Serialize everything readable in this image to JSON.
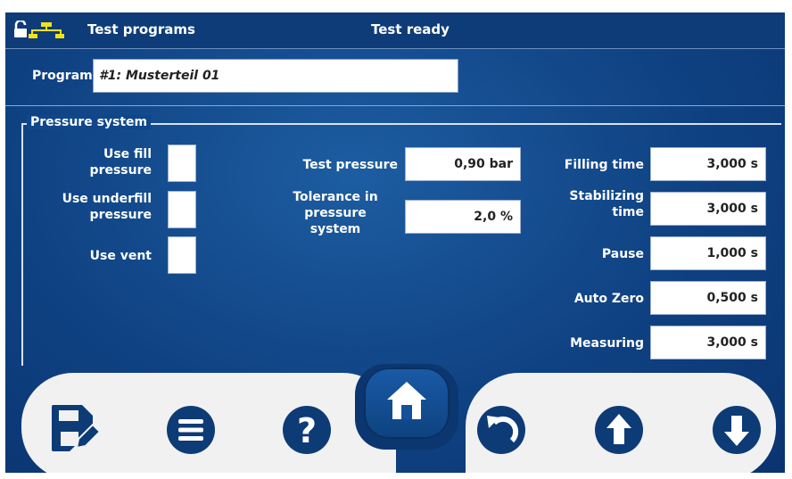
{
  "titlebar": {
    "lock_icon": "lock-open-icon",
    "network_icon": "network-icon",
    "title": "Test programs",
    "status": "Test ready"
  },
  "program": {
    "label": "Program",
    "value": "#1: Musterteil 01"
  },
  "pressure_system": {
    "legend": "Pressure system",
    "checkboxes": [
      {
        "label_line1": "Use fill",
        "label_line2": "pressure",
        "checked": false
      },
      {
        "label_line1": "Use underfill",
        "label_line2": "pressure",
        "checked": false
      },
      {
        "label_line1": "Use vent",
        "label_line2": "",
        "checked": false
      }
    ],
    "middle": [
      {
        "label": "Test pressure",
        "value": "0,90 bar"
      },
      {
        "label_lines": [
          "Tolerance in",
          "pressure",
          "system"
        ],
        "value": "2,0 %"
      }
    ],
    "times": [
      {
        "label_lines": [
          "Filling time"
        ],
        "value": "3,000 s"
      },
      {
        "label_lines": [
          "Stabilizing",
          "time"
        ],
        "value": "3,000 s"
      },
      {
        "label_lines": [
          "Pause"
        ],
        "value": "1,000 s"
      },
      {
        "label_lines": [
          "Auto Zero"
        ],
        "value": "0,500 s"
      },
      {
        "label_lines": [
          "Measuring"
        ],
        "value": "3,000 s"
      }
    ]
  },
  "toolbar": {
    "buttons": [
      "save-edit-icon",
      "menu-icon",
      "help-icon",
      "home-icon",
      "undo-icon",
      "arrow-up-icon",
      "arrow-down-icon"
    ]
  },
  "colors": {
    "background": "#10478a",
    "titlebar": "#0e3c78",
    "toolbar": "#f1f1f1",
    "icon": "#0d3b76"
  }
}
